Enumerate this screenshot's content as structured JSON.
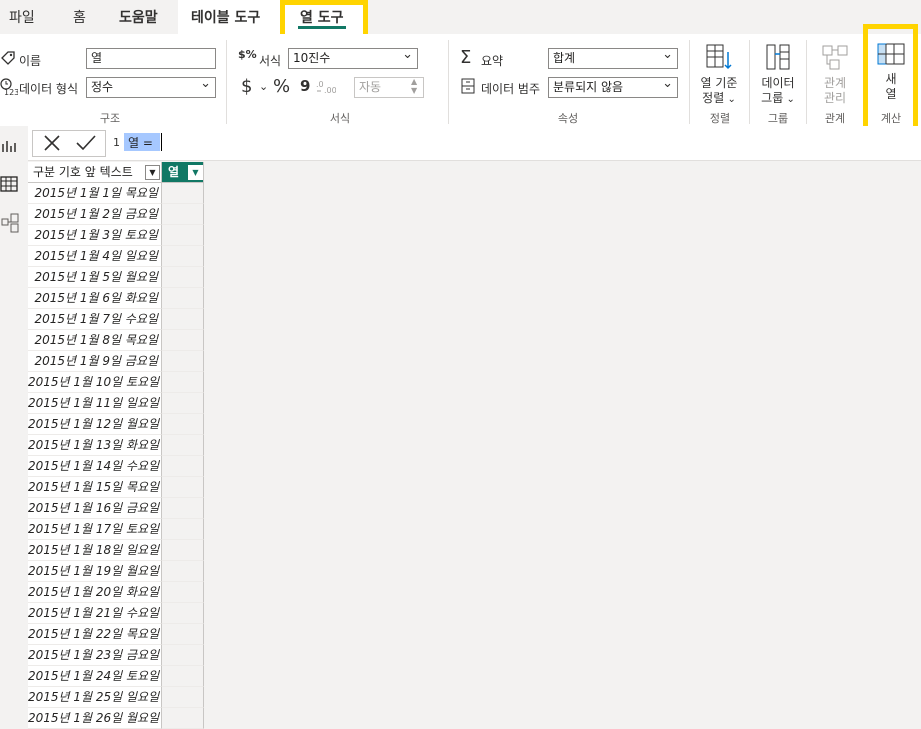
{
  "tabs": [
    "파일",
    "홈",
    "도움말",
    "테이블 도구",
    "열 도구"
  ],
  "structure": {
    "name_label": "이름",
    "name_value": "열",
    "datatype_label": "데이터 형식",
    "datatype_value": "정수",
    "group": "구조"
  },
  "format": {
    "format_label": "서식",
    "format_value": "10진수",
    "currency": "$",
    "percent": "%",
    "comma": "9",
    "decimals_value": "자동",
    "group": "서식"
  },
  "properties": {
    "summarize_label": "요약",
    "summarize_value": "합계",
    "category_label": "데이터 범주",
    "category_value": "분류되지 않음",
    "group": "속성"
  },
  "sort": {
    "label1": "열 기준",
    "label2": "정렬",
    "group": "정렬"
  },
  "groups": {
    "label1": "데이터",
    "label2": "그룹",
    "group": "그룹"
  },
  "relations": {
    "label1": "관계",
    "label2": "관리",
    "group": "관계"
  },
  "calc": {
    "label1": "새",
    "label2": "열",
    "group": "계산"
  },
  "formula": {
    "line": "1",
    "text": "열 ="
  },
  "table": {
    "col1_header": "구분 기호 앞 텍스트",
    "col2_header": "열",
    "rows": [
      "2015년 1월 1일 목요일",
      "2015년 1월 2일 금요일",
      "2015년 1월 3일 토요일",
      "2015년 1월 4일 일요일",
      "2015년 1월 5일 월요일",
      "2015년 1월 6일 화요일",
      "2015년 1월 7일 수요일",
      "2015년 1월 8일 목요일",
      "2015년 1월 9일 금요일",
      "2015년 1월 10일 토요일",
      "2015년 1월 11일 일요일",
      "2015년 1월 12일 월요일",
      "2015년 1월 13일 화요일",
      "2015년 1월 14일 수요일",
      "2015년 1월 15일 목요일",
      "2015년 1월 16일 금요일",
      "2015년 1월 17일 토요일",
      "2015년 1월 18일 일요일",
      "2015년 1월 19일 월요일",
      "2015년 1월 20일 화요일",
      "2015년 1월 21일 수요일",
      "2015년 1월 22일 목요일",
      "2015년 1월 23일 금요일",
      "2015년 1월 24일 토요일",
      "2015년 1월 25일 일요일",
      "2015년 1월 26일 월요일"
    ]
  },
  "colors": {
    "accent": "#117865",
    "highlight": "#ffd400"
  }
}
